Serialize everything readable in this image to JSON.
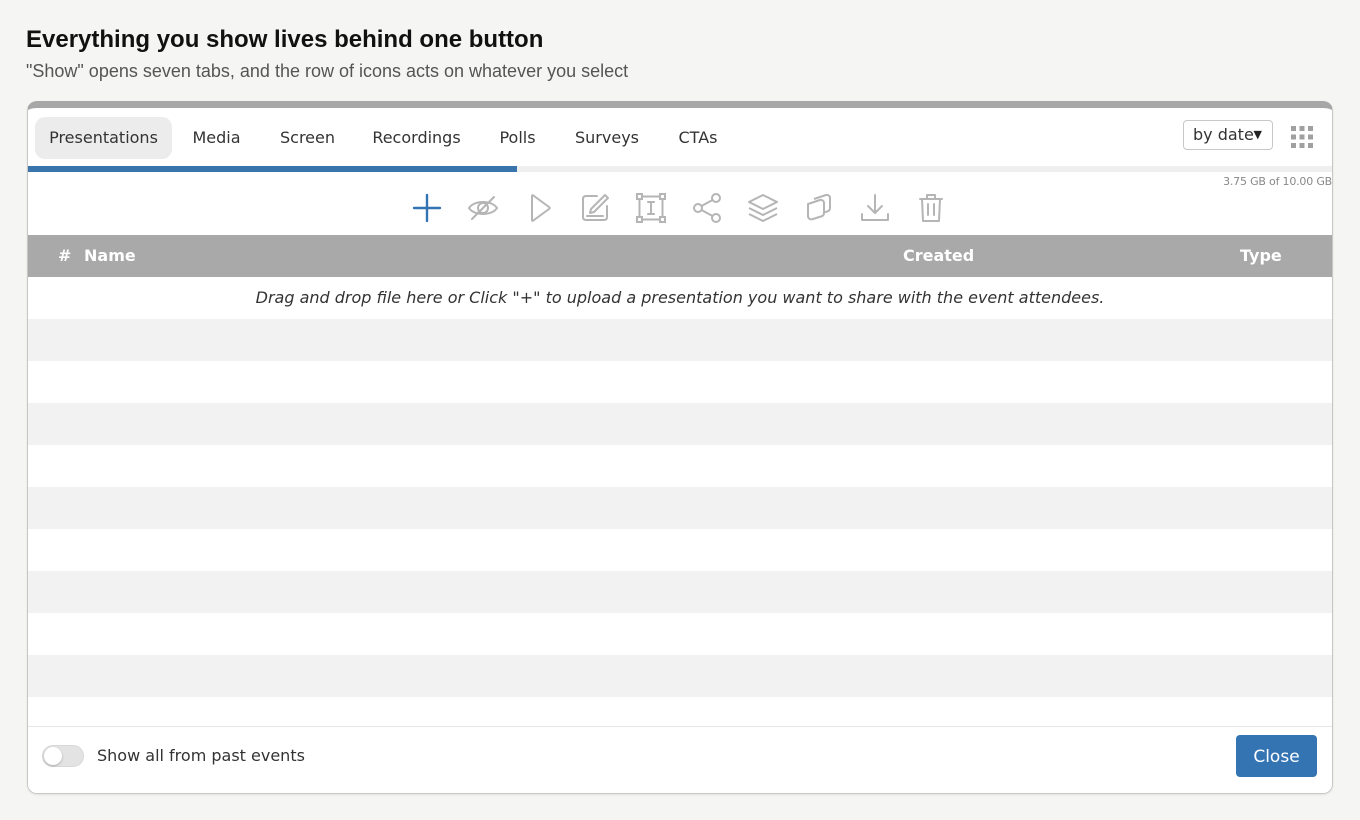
{
  "page": {
    "title": "Everything you show lives behind one button",
    "subtitle": "\"Show\" opens seven tabs, and the row of icons acts on whatever you select"
  },
  "tabs": [
    {
      "label": "Presentations",
      "active": true
    },
    {
      "label": "Media",
      "active": false
    },
    {
      "label": "Screen",
      "active": false
    },
    {
      "label": "Recordings",
      "active": false
    },
    {
      "label": "Polls",
      "active": false
    },
    {
      "label": "Surveys",
      "active": false
    },
    {
      "label": "CTAs",
      "active": false
    }
  ],
  "sort": {
    "selected": "by date"
  },
  "storage": {
    "text": "3.75 GB of 10.00 GB",
    "used_fraction": 0.375
  },
  "toolbar": {
    "icons": [
      "plus-icon",
      "eye-off-icon",
      "play-icon",
      "edit-icon",
      "resize-icon",
      "share-icon",
      "layers-icon",
      "duplicate-icon",
      "download-icon",
      "trash-icon"
    ]
  },
  "table": {
    "columns": {
      "number": "#",
      "name": "Name",
      "created": "Created",
      "type": "Type"
    },
    "empty_message": "Drag and drop file here or Click \"+\" to upload a presentation you want to share with the event attendees."
  },
  "footer": {
    "toggle_label": "Show all from past events",
    "toggle_on": false,
    "close_label": "Close"
  },
  "colors": {
    "accent": "#3574b3",
    "progress": "#3a74ad",
    "header_bg": "#a9a9a9",
    "icon_inactive": "#b5b5b5"
  }
}
